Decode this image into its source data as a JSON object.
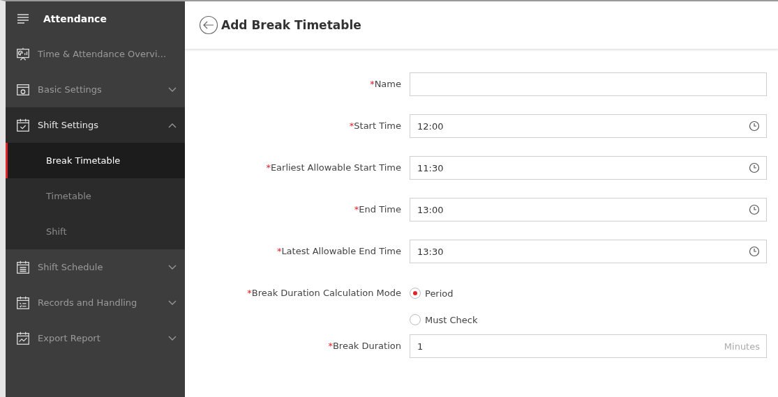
{
  "sidebar": {
    "title": "Attendance",
    "items": [
      {
        "label": "Time & Attendance Overvi...",
        "kind": "link"
      },
      {
        "label": "Basic Settings",
        "kind": "group",
        "expanded": false
      },
      {
        "label": "Shift Settings",
        "kind": "group",
        "expanded": true,
        "children": [
          {
            "label": "Break Timetable",
            "selected": true
          },
          {
            "label": "Timetable",
            "selected": false
          },
          {
            "label": "Shift",
            "selected": false
          }
        ]
      },
      {
        "label": "Shift Schedule",
        "kind": "group",
        "expanded": false
      },
      {
        "label": "Records and Handling",
        "kind": "group",
        "expanded": false
      },
      {
        "label": "Export Report",
        "kind": "group",
        "expanded": false
      }
    ]
  },
  "header": {
    "title": "Add Break Timetable"
  },
  "form": [
    {
      "kind": "text",
      "label": "Name",
      "mark": "*"
    },
    {
      "kind": "time",
      "label": "Start Time",
      "mark": "*",
      "value": "12:00"
    },
    {
      "kind": "time",
      "label": "Earliest Allowable Start Time",
      "mark": "*",
      "value": "11:30"
    },
    {
      "kind": "time",
      "label": "End Time",
      "mark": "*",
      "value": "13:00"
    },
    {
      "kind": "time",
      "label": "Latest Allowable End Time",
      "mark": "*",
      "value": "13:30"
    },
    {
      "kind": "radio",
      "label": "Break Duration Calculation Mode",
      "mark": "*",
      "options": [
        {
          "label": "Period",
          "selected": true
        },
        {
          "label": "Must Check",
          "selected": false
        }
      ]
    },
    {
      "kind": "unit",
      "label": "Break Duration",
      "mark": "*",
      "value": "1",
      "unit": "Minutes"
    }
  ]
}
